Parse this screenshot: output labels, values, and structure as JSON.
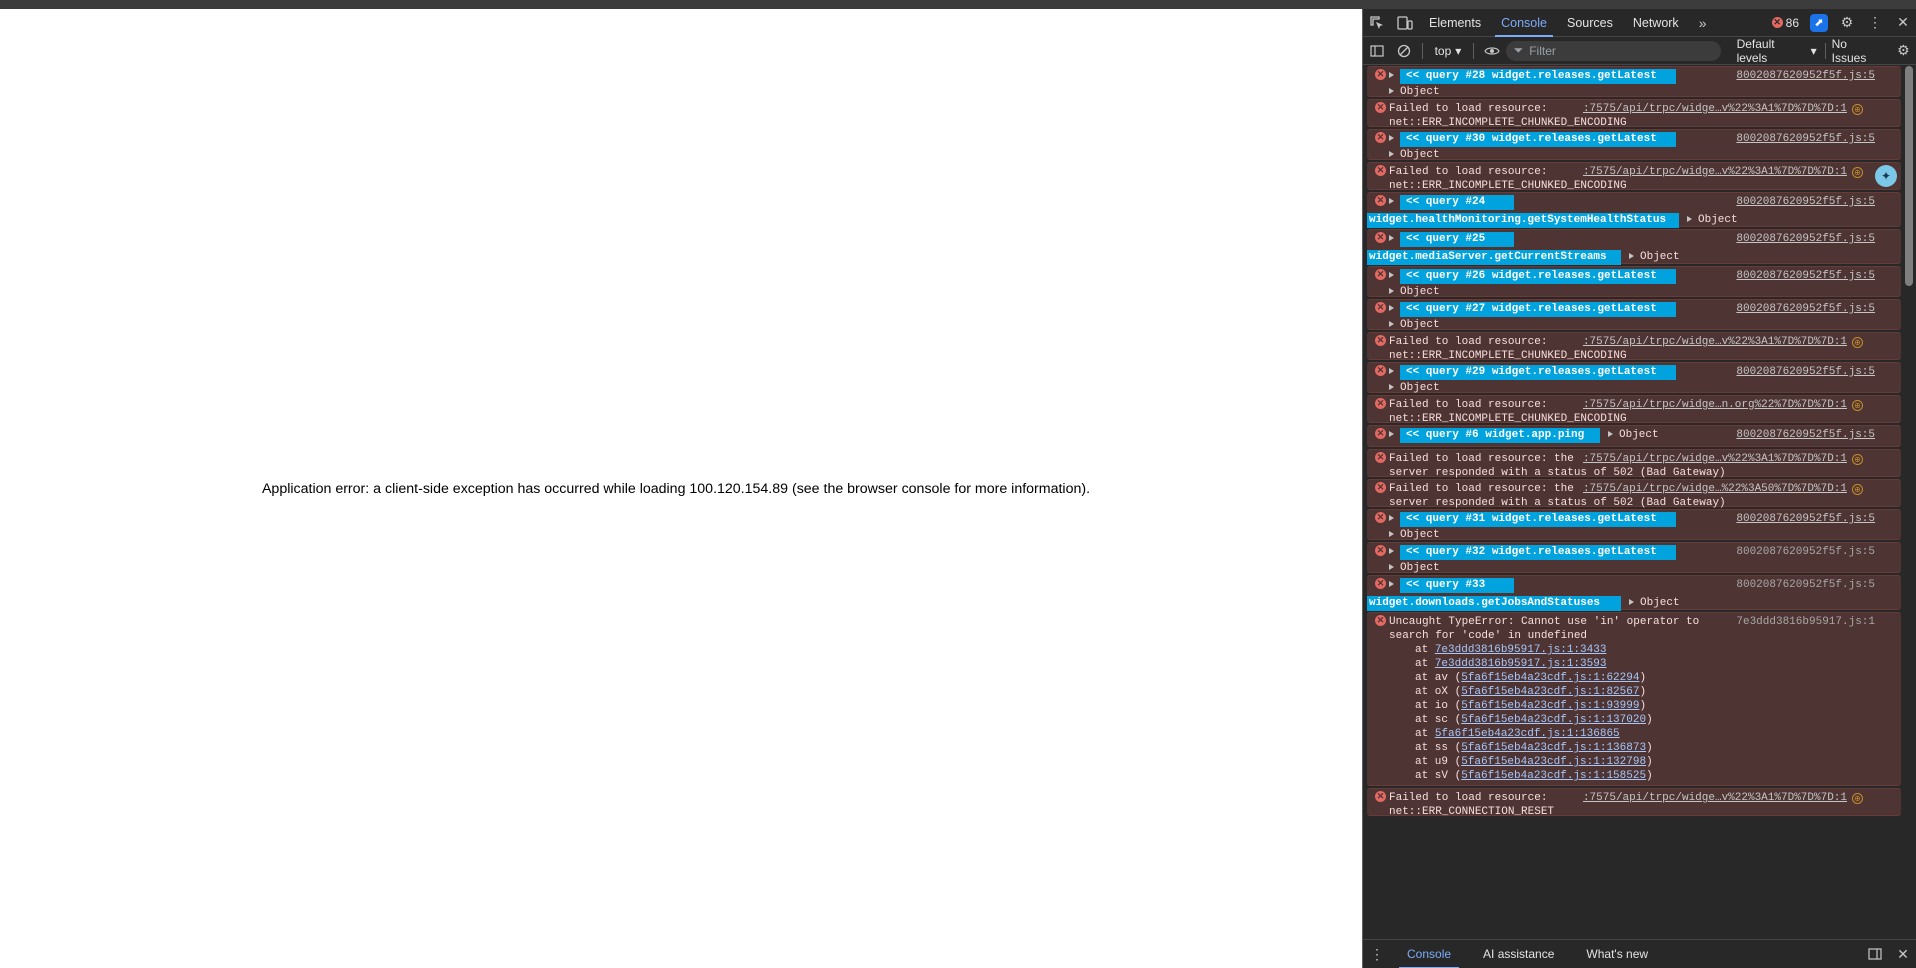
{
  "page": {
    "error_message": "Application error: a client-side exception has occurred while loading 100.120.154.89 (see the browser console for more information)."
  },
  "devtools": {
    "tabs": [
      {
        "label": "Elements"
      },
      {
        "label": "Console"
      },
      {
        "label": "Sources"
      },
      {
        "label": "Network"
      }
    ],
    "more_tabs": "»",
    "error_count": "86",
    "toolbar": {
      "context": "top",
      "filter_placeholder": "Filter",
      "levels": "Default levels",
      "issues": "No Issues"
    },
    "bottom_tabs": [
      {
        "label": "Console"
      },
      {
        "label": "AI assistance"
      },
      {
        "label": "What's new"
      }
    ],
    "messages": [
      {
        "type": "query",
        "tag": "<< query #28  widget.releases.getLatest",
        "second": "Object",
        "source": "8002087620952f5f.js:5"
      },
      {
        "type": "failed",
        "line1": "Failed to load resource:",
        "url": ":7575/api/trpc/widge…v%22%3A1%7D%7D%7D:1",
        "line2": "net::ERR_INCOMPLETE_CHUNKED_ENCODING"
      },
      {
        "type": "query",
        "tag": "<< query #30  widget.releases.getLatest",
        "second": "Object",
        "source": "8002087620952f5f.js:5"
      },
      {
        "type": "failed",
        "line1": "Failed to load resource:",
        "url": ":7575/api/trpc/widge…v%22%3A1%7D%7D%7D:1",
        "line2": "net::ERR_INCOMPLETE_CHUNKED_ENCODING"
      },
      {
        "type": "query2",
        "tag": "<< query #24",
        "tag2": "widget.healthMonitoring.getSystemHealthStatus",
        "second": "Object",
        "source": "8002087620952f5f.js:5"
      },
      {
        "type": "query2",
        "tag": "<< query #25",
        "tag2": "widget.mediaServer.getCurrentStreams",
        "second": "Object",
        "source": "8002087620952f5f.js:5"
      },
      {
        "type": "query",
        "tag": "<< query #26  widget.releases.getLatest",
        "second": "Object",
        "source": "8002087620952f5f.js:5"
      },
      {
        "type": "query",
        "tag": "<< query #27  widget.releases.getLatest",
        "second": "Object",
        "source": "8002087620952f5f.js:5"
      },
      {
        "type": "failed",
        "line1": "Failed to load resource:",
        "url": ":7575/api/trpc/widge…v%22%3A1%7D%7D%7D:1",
        "line2": "net::ERR_INCOMPLETE_CHUNKED_ENCODING"
      },
      {
        "type": "query",
        "tag": "<< query #29  widget.releases.getLatest",
        "second": "Object",
        "source": "8002087620952f5f.js:5"
      },
      {
        "type": "failed",
        "line1": "Failed to load resource:",
        "url": ":7575/api/trpc/widge…n.org%22%7D%7D%7D:1",
        "line2": "net::ERR_INCOMPLETE_CHUNKED_ENCODING"
      },
      {
        "type": "ping",
        "tag": "<< query #6  widget.app.ping",
        "second": "Object",
        "source": "8002087620952f5f.js:5"
      },
      {
        "type": "failed",
        "line1": "Failed to load resource: the",
        "url": ":7575/api/trpc/widge…v%22%3A1%7D%7D%7D:1",
        "line2": "server responded with a status of 502 (Bad Gateway)"
      },
      {
        "type": "failed",
        "line1": "Failed to load resource: the",
        "url": ":7575/api/trpc/widge…%22%3A50%7D%7D%7D:1",
        "line2": "server responded with a status of 502 (Bad Gateway)"
      },
      {
        "type": "query",
        "tag": "<< query #31  widget.releases.getLatest",
        "second": "Object",
        "source": "8002087620952f5f.js:5"
      },
      {
        "type": "query",
        "tag": "<< query #32  widget.releases.getLatest",
        "second": "Object",
        "source": "8002087620952f5f.js:5"
      },
      {
        "type": "query2",
        "tag": "<< query #33",
        "tag2": "widget.downloads.getJobsAndStatuses",
        "second": "Object",
        "source": "8002087620952f5f.js:5"
      }
    ],
    "uncaught": {
      "line1": "Uncaught TypeError: Cannot use 'in' operator to",
      "line2": "search for 'code' in undefined",
      "source": "7e3ddd3816b95917.js:1",
      "stack": [
        {
          "prefix": "at ",
          "link": "7e3ddd3816b95917.js:1:3433",
          "wrap": false
        },
        {
          "prefix": "at ",
          "link": "7e3ddd3816b95917.js:1:3593",
          "wrap": false
        },
        {
          "prefix": "at av ",
          "link": "5fa6f15eb4a23cdf.js:1:62294",
          "wrap": true
        },
        {
          "prefix": "at oX ",
          "link": "5fa6f15eb4a23cdf.js:1:82567",
          "wrap": true
        },
        {
          "prefix": "at io ",
          "link": "5fa6f15eb4a23cdf.js:1:93999",
          "wrap": true
        },
        {
          "prefix": "at sc ",
          "link": "5fa6f15eb4a23cdf.js:1:137020",
          "wrap": true
        },
        {
          "prefix": "at ",
          "link": "5fa6f15eb4a23cdf.js:1:136865",
          "wrap": false
        },
        {
          "prefix": "at ss ",
          "link": "5fa6f15eb4a23cdf.js:1:136873",
          "wrap": true
        },
        {
          "prefix": "at u9 ",
          "link": "5fa6f15eb4a23cdf.js:1:132798",
          "wrap": true
        },
        {
          "prefix": "at sV ",
          "link": "5fa6f15eb4a23cdf.js:1:158525",
          "wrap": true
        }
      ]
    },
    "last_failed": {
      "line1": "Failed to load resource:",
      "url": ":7575/api/trpc/widge…v%22%3A1%7D%7D%7D:1",
      "line2": "net::ERR_CONNECTION_RESET"
    }
  }
}
